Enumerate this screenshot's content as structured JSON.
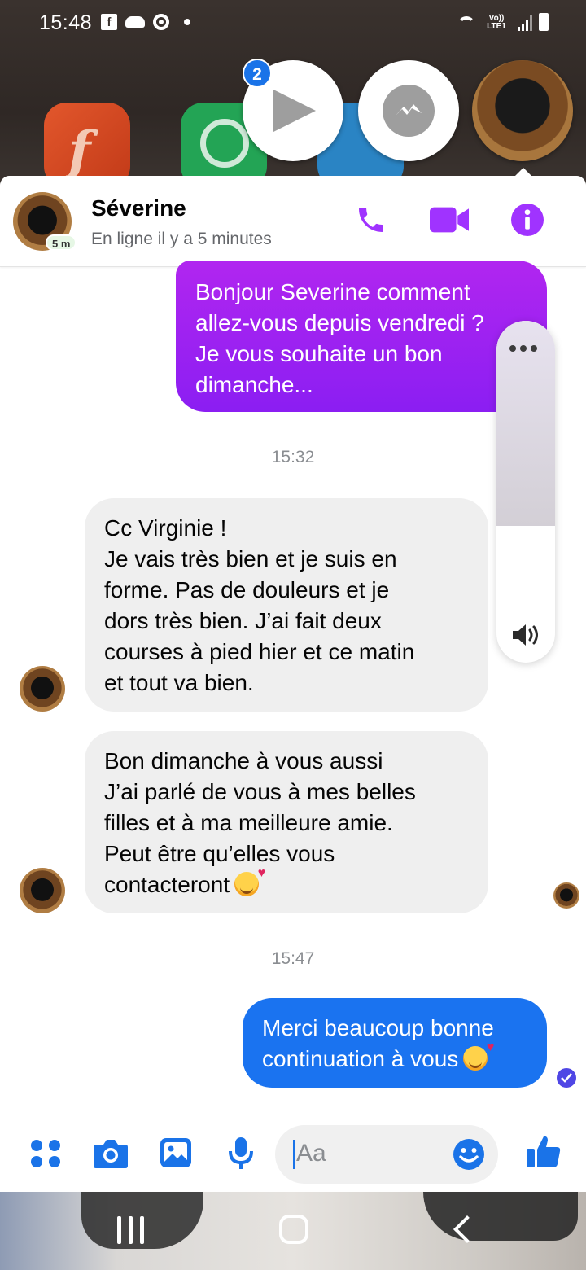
{
  "status_bar": {
    "time": "15:48",
    "notification_icons": [
      "facebook-icon",
      "weather-icon",
      "chrome-icon",
      "dot-icon"
    ],
    "network_label": "Vo)) LTE1",
    "system_icons": [
      "wifi-icon",
      "signal-icon",
      "battery-icon"
    ]
  },
  "chat_heads": {
    "badge_count": "2",
    "items": [
      "play-video-head",
      "messenger-head",
      "contact-avatar-head"
    ]
  },
  "header": {
    "contact_name": "Séverine",
    "active_chip": "5 m",
    "presence": "En ligne il y a 5 minutes",
    "actions": [
      "phone-icon",
      "video-camera-icon",
      "info-icon"
    ]
  },
  "messages": {
    "outgoing_1": {
      "lines": [
        "Bonjour Severine comment",
        "allez-vous depuis vendredi ?",
        "Je vous souhaite un bon",
        "dimanche..."
      ]
    },
    "timestamp_1": "15:32",
    "incoming_1": {
      "lines": [
        "Cc Virginie !",
        "Je vais très bien et je suis en",
        "forme. Pas de douleurs et je",
        "dors très bien. J’ai fait deux",
        "courses à pied hier et ce matin",
        "et tout va bien."
      ]
    },
    "incoming_2": {
      "lines": [
        "Bon dimanche à vous aussi",
        "J’ai parlé de vous à mes belles",
        "filles et à ma meilleure amie.",
        "Peut être qu’elles vous",
        "contacteront"
      ],
      "emoji": "smiling-face-with-hearts"
    },
    "timestamp_2": "15:47",
    "outgoing_2": {
      "lines": [
        "Merci beaucoup bonne",
        "continuation à vous"
      ],
      "emoji": "smiling-face-with-hearts",
      "status": "sent-check-icon"
    }
  },
  "volume_overlay": {
    "level": 0.6,
    "icons": [
      "more-options-icon",
      "speaker-icon"
    ]
  },
  "composer": {
    "placeholder": "Aa",
    "actions": [
      "more-actions-icon",
      "camera-icon",
      "gallery-icon",
      "microphone-icon",
      "emoji-icon",
      "like-icon"
    ]
  },
  "colors": {
    "messenger_purple": "#a033ff",
    "outgoing_gradient_top": "#b126f0",
    "outgoing_blue": "#1a73f0",
    "incoming_gray": "#efefef",
    "icon_blue": "#1a73e8"
  }
}
